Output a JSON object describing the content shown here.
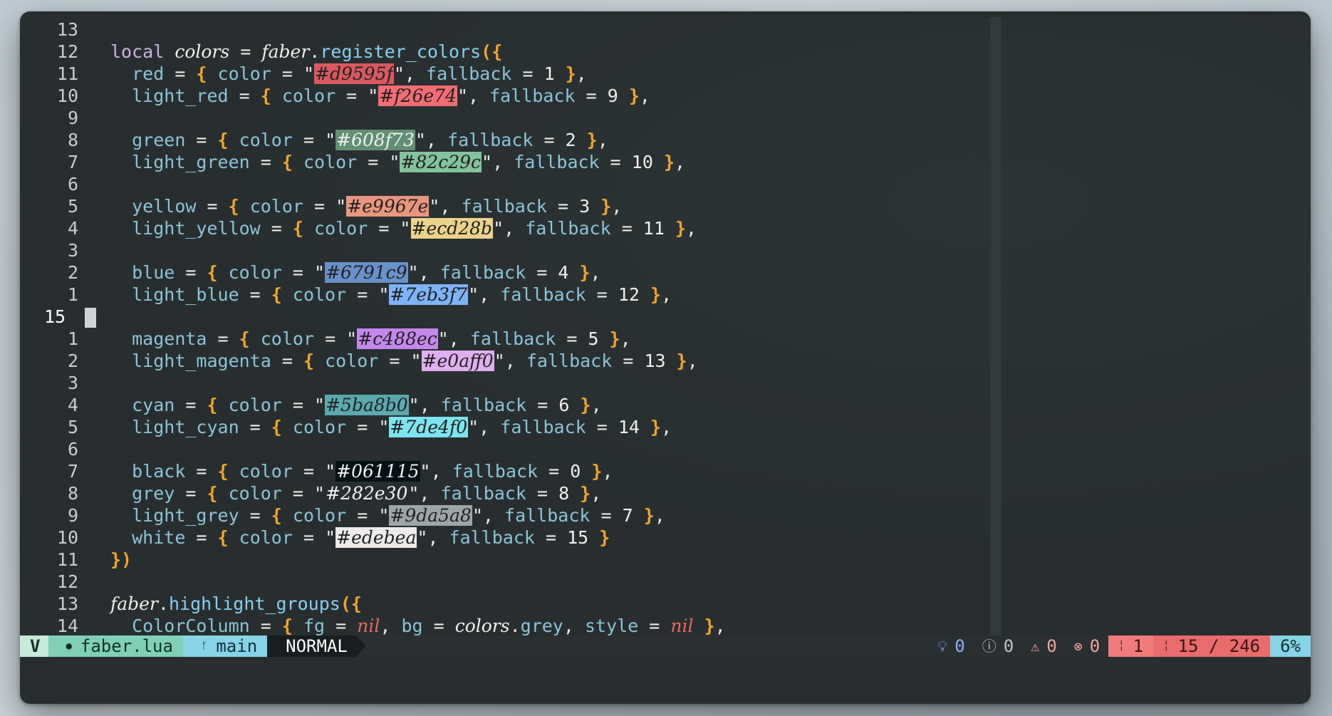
{
  "editor": {
    "lines": [
      {
        "ln": "13",
        "tokens": []
      },
      {
        "ln": "12",
        "tokens": [
          [
            "kw",
            "local"
          ],
          [
            "op",
            " "
          ],
          [
            "id",
            "colors"
          ],
          [
            "op",
            " = "
          ],
          [
            "id",
            "faber"
          ],
          [
            "op",
            "."
          ],
          [
            "fn",
            "register_colors"
          ],
          [
            "pu",
            "({"
          ]
        ]
      },
      {
        "ln": "11",
        "tokens": [
          [
            "op",
            "  "
          ],
          [
            "fld",
            "red"
          ],
          [
            "op",
            " = "
          ],
          [
            "pu",
            "{"
          ],
          [
            "op",
            " "
          ],
          [
            "fld",
            "color"
          ],
          [
            "op",
            " = \""
          ],
          [
            "sw",
            "#d9595f",
            "#d9595f",
            "#222"
          ],
          [
            "op",
            "\", "
          ],
          [
            "fld",
            "fallback"
          ],
          [
            "op",
            " = "
          ],
          [
            "num",
            "1"
          ],
          [
            "op",
            " "
          ],
          [
            "pu",
            "}"
          ],
          [
            "op",
            ","
          ]
        ]
      },
      {
        "ln": "10",
        "tokens": [
          [
            "op",
            "  "
          ],
          [
            "fld",
            "light_red"
          ],
          [
            "op",
            " = "
          ],
          [
            "pu",
            "{"
          ],
          [
            "op",
            " "
          ],
          [
            "fld",
            "color"
          ],
          [
            "op",
            " = \""
          ],
          [
            "sw",
            "#f26e74",
            "#f26e74",
            "#222"
          ],
          [
            "op",
            "\", "
          ],
          [
            "fld",
            "fallback"
          ],
          [
            "op",
            " = "
          ],
          [
            "num",
            "9"
          ],
          [
            "op",
            " "
          ],
          [
            "pu",
            "}"
          ],
          [
            "op",
            ","
          ]
        ]
      },
      {
        "ln": "9",
        "tokens": []
      },
      {
        "ln": "8",
        "tokens": [
          [
            "op",
            "  "
          ],
          [
            "fld",
            "green"
          ],
          [
            "op",
            " = "
          ],
          [
            "pu",
            "{"
          ],
          [
            "op",
            " "
          ],
          [
            "fld",
            "color"
          ],
          [
            "op",
            " = \""
          ],
          [
            "sw",
            "#608f73",
            "#608f73",
            "#f2f2f2"
          ],
          [
            "op",
            "\", "
          ],
          [
            "fld",
            "fallback"
          ],
          [
            "op",
            " = "
          ],
          [
            "num",
            "2"
          ],
          [
            "op",
            " "
          ],
          [
            "pu",
            "}"
          ],
          [
            "op",
            ","
          ]
        ]
      },
      {
        "ln": "7",
        "tokens": [
          [
            "op",
            "  "
          ],
          [
            "fld",
            "light_green"
          ],
          [
            "op",
            " = "
          ],
          [
            "pu",
            "{"
          ],
          [
            "op",
            " "
          ],
          [
            "fld",
            "color"
          ],
          [
            "op",
            " = \""
          ],
          [
            "sw",
            "#82c29c",
            "#82c29c",
            "#222"
          ],
          [
            "op",
            "\", "
          ],
          [
            "fld",
            "fallback"
          ],
          [
            "op",
            " = "
          ],
          [
            "num",
            "10"
          ],
          [
            "op",
            " "
          ],
          [
            "pu",
            "}"
          ],
          [
            "op",
            ","
          ]
        ]
      },
      {
        "ln": "6",
        "tokens": []
      },
      {
        "ln": "5",
        "tokens": [
          [
            "op",
            "  "
          ],
          [
            "fld",
            "yellow"
          ],
          [
            "op",
            " = "
          ],
          [
            "pu",
            "{"
          ],
          [
            "op",
            " "
          ],
          [
            "fld",
            "color"
          ],
          [
            "op",
            " = \""
          ],
          [
            "sw",
            "#e9967e",
            "#e9967e",
            "#222"
          ],
          [
            "op",
            "\", "
          ],
          [
            "fld",
            "fallback"
          ],
          [
            "op",
            " = "
          ],
          [
            "num",
            "3"
          ],
          [
            "op",
            " "
          ],
          [
            "pu",
            "}"
          ],
          [
            "op",
            ","
          ]
        ]
      },
      {
        "ln": "4",
        "tokens": [
          [
            "op",
            "  "
          ],
          [
            "fld",
            "light_yellow"
          ],
          [
            "op",
            " = "
          ],
          [
            "pu",
            "{"
          ],
          [
            "op",
            " "
          ],
          [
            "fld",
            "color"
          ],
          [
            "op",
            " = \""
          ],
          [
            "sw",
            "#ecd28b",
            "#ecd28b",
            "#222"
          ],
          [
            "op",
            "\", "
          ],
          [
            "fld",
            "fallback"
          ],
          [
            "op",
            " = "
          ],
          [
            "num",
            "11"
          ],
          [
            "op",
            " "
          ],
          [
            "pu",
            "}"
          ],
          [
            "op",
            ","
          ]
        ]
      },
      {
        "ln": "3",
        "tokens": []
      },
      {
        "ln": "2",
        "tokens": [
          [
            "op",
            "  "
          ],
          [
            "fld",
            "blue"
          ],
          [
            "op",
            " = "
          ],
          [
            "pu",
            "{"
          ],
          [
            "op",
            " "
          ],
          [
            "fld",
            "color"
          ],
          [
            "op",
            " = \""
          ],
          [
            "sw",
            "#6791c9",
            "#6791c9",
            "#222"
          ],
          [
            "op",
            "\", "
          ],
          [
            "fld",
            "fallback"
          ],
          [
            "op",
            " = "
          ],
          [
            "num",
            "4"
          ],
          [
            "op",
            " "
          ],
          [
            "pu",
            "}"
          ],
          [
            "op",
            ","
          ]
        ]
      },
      {
        "ln": "1",
        "tokens": [
          [
            "op",
            "  "
          ],
          [
            "fld",
            "light_blue"
          ],
          [
            "op",
            " = "
          ],
          [
            "pu",
            "{"
          ],
          [
            "op",
            " "
          ],
          [
            "fld",
            "color"
          ],
          [
            "op",
            " = \""
          ],
          [
            "sw",
            "#7eb3f7",
            "#7eb3f7",
            "#222"
          ],
          [
            "op",
            "\", "
          ],
          [
            "fld",
            "fallback"
          ],
          [
            "op",
            " = "
          ],
          [
            "num",
            "12"
          ],
          [
            "op",
            " "
          ],
          [
            "pu",
            "}"
          ],
          [
            "op",
            ","
          ]
        ]
      },
      {
        "ln": "15",
        "current": true,
        "tokens": []
      },
      {
        "ln": "1",
        "tokens": [
          [
            "op",
            "  "
          ],
          [
            "fld",
            "magenta"
          ],
          [
            "op",
            " = "
          ],
          [
            "pu",
            "{"
          ],
          [
            "op",
            " "
          ],
          [
            "fld",
            "color"
          ],
          [
            "op",
            " = \""
          ],
          [
            "sw",
            "#c488ec",
            "#c488ec",
            "#222"
          ],
          [
            "op",
            "\", "
          ],
          [
            "fld",
            "fallback"
          ],
          [
            "op",
            " = "
          ],
          [
            "num",
            "5"
          ],
          [
            "op",
            " "
          ],
          [
            "pu",
            "}"
          ],
          [
            "op",
            ","
          ]
        ]
      },
      {
        "ln": "2",
        "tokens": [
          [
            "op",
            "  "
          ],
          [
            "fld",
            "light_magenta"
          ],
          [
            "op",
            " = "
          ],
          [
            "pu",
            "{"
          ],
          [
            "op",
            " "
          ],
          [
            "fld",
            "color"
          ],
          [
            "op",
            " = \""
          ],
          [
            "sw",
            "#e0aff0",
            "#e0aff0",
            "#222"
          ],
          [
            "op",
            "\", "
          ],
          [
            "fld",
            "fallback"
          ],
          [
            "op",
            " = "
          ],
          [
            "num",
            "13"
          ],
          [
            "op",
            " "
          ],
          [
            "pu",
            "}"
          ],
          [
            "op",
            ","
          ]
        ]
      },
      {
        "ln": "3",
        "tokens": []
      },
      {
        "ln": "4",
        "tokens": [
          [
            "op",
            "  "
          ],
          [
            "fld",
            "cyan"
          ],
          [
            "op",
            " = "
          ],
          [
            "pu",
            "{"
          ],
          [
            "op",
            " "
          ],
          [
            "fld",
            "color"
          ],
          [
            "op",
            " = \""
          ],
          [
            "sw",
            "#5ba8b0",
            "#5ba8b0",
            "#222"
          ],
          [
            "op",
            "\", "
          ],
          [
            "fld",
            "fallback"
          ],
          [
            "op",
            " = "
          ],
          [
            "num",
            "6"
          ],
          [
            "op",
            " "
          ],
          [
            "pu",
            "}"
          ],
          [
            "op",
            ","
          ]
        ]
      },
      {
        "ln": "5",
        "tokens": [
          [
            "op",
            "  "
          ],
          [
            "fld",
            "light_cyan"
          ],
          [
            "op",
            " = "
          ],
          [
            "pu",
            "{"
          ],
          [
            "op",
            " "
          ],
          [
            "fld",
            "color"
          ],
          [
            "op",
            " = \""
          ],
          [
            "sw",
            "#7de4f0",
            "#7de4f0",
            "#222"
          ],
          [
            "op",
            "\", "
          ],
          [
            "fld",
            "fallback"
          ],
          [
            "op",
            " = "
          ],
          [
            "num",
            "14"
          ],
          [
            "op",
            " "
          ],
          [
            "pu",
            "}"
          ],
          [
            "op",
            ","
          ]
        ]
      },
      {
        "ln": "6",
        "tokens": []
      },
      {
        "ln": "7",
        "tokens": [
          [
            "op",
            "  "
          ],
          [
            "fld",
            "black"
          ],
          [
            "op",
            " = "
          ],
          [
            "pu",
            "{"
          ],
          [
            "op",
            " "
          ],
          [
            "fld",
            "color"
          ],
          [
            "op",
            " = \""
          ],
          [
            "sw",
            "#061115",
            "#061115",
            "#f2f2f2"
          ],
          [
            "op",
            "\", "
          ],
          [
            "fld",
            "fallback"
          ],
          [
            "op",
            " = "
          ],
          [
            "num",
            "0"
          ],
          [
            "op",
            " "
          ],
          [
            "pu",
            "}"
          ],
          [
            "op",
            ","
          ]
        ]
      },
      {
        "ln": "8",
        "tokens": [
          [
            "op",
            "  "
          ],
          [
            "fld",
            "grey"
          ],
          [
            "op",
            " = "
          ],
          [
            "pu",
            "{"
          ],
          [
            "op",
            " "
          ],
          [
            "fld",
            "color"
          ],
          [
            "op",
            " = \""
          ],
          [
            "sw",
            "#282e30",
            "#282e30",
            "#f2f2f2"
          ],
          [
            "op",
            "\", "
          ],
          [
            "fld",
            "fallback"
          ],
          [
            "op",
            " = "
          ],
          [
            "num",
            "8"
          ],
          [
            "op",
            " "
          ],
          [
            "pu",
            "}"
          ],
          [
            "op",
            ","
          ]
        ]
      },
      {
        "ln": "9",
        "tokens": [
          [
            "op",
            "  "
          ],
          [
            "fld",
            "light_grey"
          ],
          [
            "op",
            " = "
          ],
          [
            "pu",
            "{"
          ],
          [
            "op",
            " "
          ],
          [
            "fld",
            "color"
          ],
          [
            "op",
            " = \""
          ],
          [
            "sw",
            "#9da5a8",
            "#9da5a8",
            "#222"
          ],
          [
            "op",
            "\", "
          ],
          [
            "fld",
            "fallback"
          ],
          [
            "op",
            " = "
          ],
          [
            "num",
            "7"
          ],
          [
            "op",
            " "
          ],
          [
            "pu",
            "}"
          ],
          [
            "op",
            ","
          ]
        ]
      },
      {
        "ln": "10",
        "tokens": [
          [
            "op",
            "  "
          ],
          [
            "fld",
            "white"
          ],
          [
            "op",
            " = "
          ],
          [
            "pu",
            "{"
          ],
          [
            "op",
            " "
          ],
          [
            "fld",
            "color"
          ],
          [
            "op",
            " = \""
          ],
          [
            "sw",
            "#edebea",
            "#edebea",
            "#222"
          ],
          [
            "op",
            "\", "
          ],
          [
            "fld",
            "fallback"
          ],
          [
            "op",
            " = "
          ],
          [
            "num",
            "15"
          ],
          [
            "op",
            " "
          ],
          [
            "pu",
            "}"
          ]
        ]
      },
      {
        "ln": "11",
        "tokens": [
          [
            "pu",
            "})"
          ]
        ]
      },
      {
        "ln": "12",
        "tokens": []
      },
      {
        "ln": "13",
        "tokens": [
          [
            "id",
            "faber"
          ],
          [
            "op",
            "."
          ],
          [
            "fn",
            "highlight_groups"
          ],
          [
            "pu",
            "({"
          ]
        ]
      },
      {
        "ln": "14",
        "tokens": [
          [
            "op",
            "  "
          ],
          [
            "fld",
            "ColorColumn"
          ],
          [
            "op",
            " = "
          ],
          [
            "pu",
            "{"
          ],
          [
            "op",
            " "
          ],
          [
            "fld",
            "fg"
          ],
          [
            "op",
            " = "
          ],
          [
            "nil",
            "nil"
          ],
          [
            "op",
            ", "
          ],
          [
            "fld",
            "bg"
          ],
          [
            "op",
            " = "
          ],
          [
            "id",
            "colors"
          ],
          [
            "op",
            "."
          ],
          [
            "fld",
            "grey"
          ],
          [
            "op",
            ", "
          ],
          [
            "fld",
            "style"
          ],
          [
            "op",
            " = "
          ],
          [
            "nil",
            "nil"
          ],
          [
            "op",
            " "
          ],
          [
            "pu",
            "}"
          ],
          [
            "op",
            ","
          ]
        ]
      }
    ]
  },
  "statusline": {
    "mode_glyph": "V",
    "file_icon": "●",
    "file_name": "faber.lua",
    "branch_icon": "ᚶ",
    "branch_name": "main",
    "vim_mode": "NORMAL",
    "diagnostics": {
      "hint_count": "0",
      "info_count": "0",
      "warn_count": "0",
      "error_count": "0"
    },
    "column": "1",
    "line_position": "15 / 246",
    "percent": "6%"
  },
  "colors": {
    "background": "#282e30",
    "accent_green": "#7fd0b6",
    "accent_cyan": "#86d4e6",
    "accent_red": "#e86c6c"
  }
}
